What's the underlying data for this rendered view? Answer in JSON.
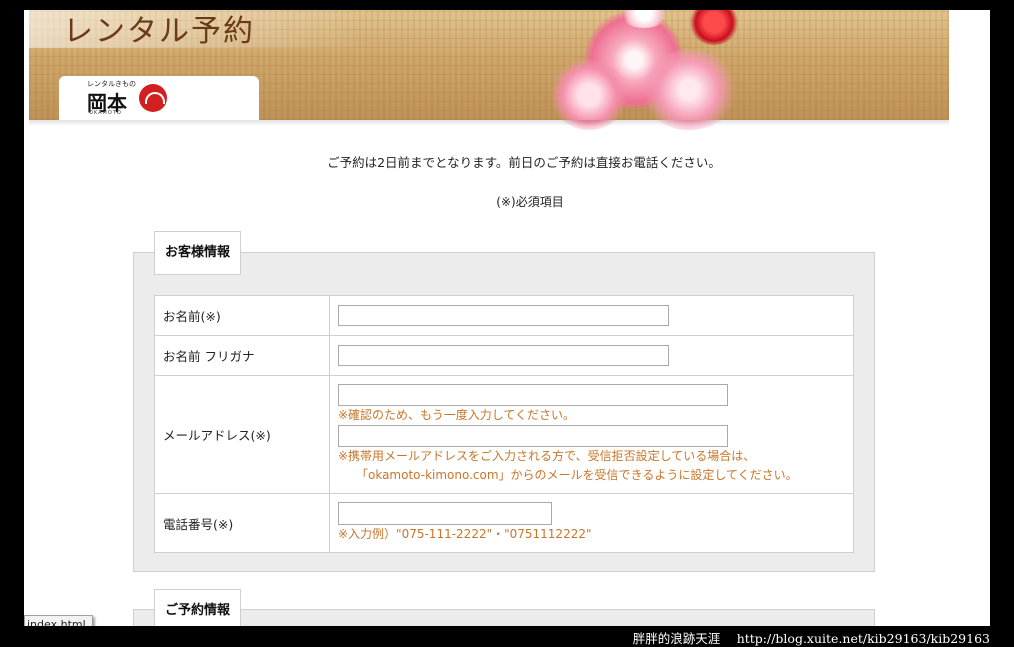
{
  "header": {
    "title": "レンタル予約",
    "logo": {
      "small_text": "レンタルきもの",
      "main_text": "岡本",
      "roman_text": "OKAMOTO"
    }
  },
  "notice": "ご予約は2日前までとなります。前日のご予約は直接お電話ください。",
  "required_note": "(※)必須項目",
  "customer_section": {
    "legend": "お客様情報",
    "rows": {
      "name": {
        "label": "お名前(※)",
        "value": ""
      },
      "kana": {
        "label": "お名前 フリガナ",
        "value": ""
      },
      "email": {
        "label": "メールアドレス(※)",
        "value": "",
        "confirm_value": "",
        "confirm_hint": "※確認のため、もう一度入力してください。",
        "mobile_hint_1": "※携帯用メールアドレスをご入力される方で、受信拒否設定している場合は、",
        "mobile_hint_2": "「okamoto-kimono.com」からのメールを受信できるように設定してください。"
      },
      "phone": {
        "label": "電話番号(※)",
        "value": "",
        "hint": "※入力例）\"075-111-2222\"・\"0751112222\""
      }
    }
  },
  "reservation_section": {
    "legend": "ご予約情報"
  },
  "status_bar": {
    "link": "index.html"
  },
  "watermark": "胖胖的浪跡天涯　 http://blog.xuite.net/kib29163/kib29163",
  "colors": {
    "hint": "#c8762b",
    "background": "#000000",
    "fieldset": "#ececec"
  }
}
